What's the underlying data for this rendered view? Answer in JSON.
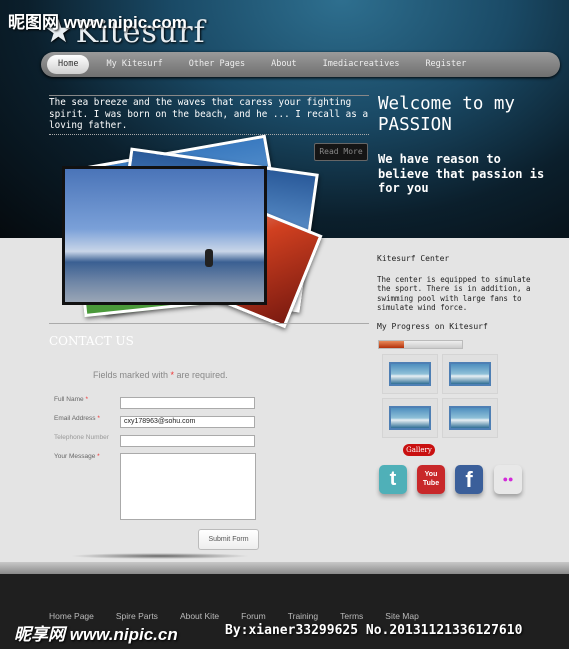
{
  "header": {
    "logo": "Kitesurf",
    "logo_icon": "star-icon"
  },
  "nav": {
    "items": [
      "Home",
      "My Kitesurf",
      "Other Pages",
      "About",
      "Imediacreatives",
      "Register"
    ],
    "active": "Home"
  },
  "intro": {
    "text": "The sea breeze and the waves that caress your fighting spirit. I was born on the beach, and he ... I recall as a loving father.",
    "read_more": "Read More"
  },
  "welcome": {
    "title_line1": "Welcome to my",
    "title_line2": "PASSION",
    "subtitle": "We have reason to believe that passion is for you"
  },
  "contact": {
    "title": "CONTACT US",
    "note_prefix": "Fields marked with ",
    "note_star": "*",
    "note_suffix": " are required.",
    "fields": [
      {
        "label": "Full Name",
        "required": "*",
        "value": ""
      },
      {
        "label": "Email Address",
        "required": "*",
        "value": "cxy178963@sohu.com"
      },
      {
        "label": "Telephone Number",
        "required": "",
        "value": ""
      }
    ],
    "message_label": "Your Message",
    "message_required": "*",
    "submit": "Submit Form"
  },
  "sidebar": {
    "center_title": "Kitesurf Center",
    "center_text": "The center is equipped to simulate the sport. There is in addition, a swimming pool with large fans to simulate wind force.",
    "progress_label": "My Progress on Kitesurf",
    "progress_percent": 30,
    "gallery_button": "Gallery",
    "social": [
      {
        "name": "twitter",
        "glyph": "t",
        "color": "#4fb0b8"
      },
      {
        "name": "youtube",
        "glyph": "You Tube",
        "color": "#c8282a"
      },
      {
        "name": "facebook",
        "glyph": "f",
        "color": "#3b5f9a"
      },
      {
        "name": "flickr",
        "glyph": "●●",
        "color": "#e8e8e8"
      }
    ]
  },
  "footer": {
    "links": [
      "Home Page",
      "Spire Parts",
      "About Kite",
      "Forum",
      "Training",
      "Terms",
      "Site Map"
    ]
  },
  "watermark": {
    "top": "昵图网 www.nipic.com",
    "bottom": "昵享网 www.nipic.cn",
    "bottom_id": "By:xianer33299625 No.20131121336127610"
  },
  "colors": {
    "accent_red": "#c91010",
    "progress": "#b3300a"
  }
}
